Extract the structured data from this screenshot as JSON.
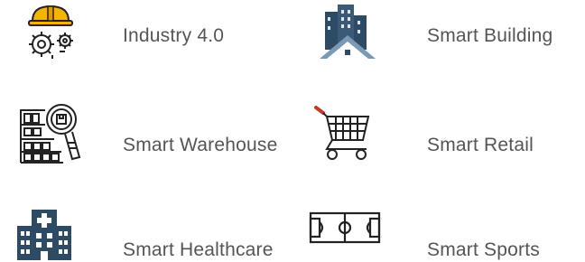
{
  "items": [
    {
      "label": "Industry 4.0",
      "icon": "worker-helmet-gears-icon"
    },
    {
      "label": "Smart Building",
      "icon": "city-buildings-icon"
    },
    {
      "label": "Smart Warehouse",
      "icon": "warehouse-magnifier-icon"
    },
    {
      "label": "Smart Retail",
      "icon": "shopping-cart-icon"
    },
    {
      "label": "Smart Healthcare",
      "icon": "hospital-icon"
    },
    {
      "label": "Smart Sports",
      "icon": "soccer-field-icon"
    }
  ],
  "colors": {
    "text": "#555555",
    "helmet": "#f5b400",
    "building": "#2e4b66",
    "roof": "#7a99b3",
    "stroke": "#222222",
    "cart-handle": "#c0392b"
  }
}
